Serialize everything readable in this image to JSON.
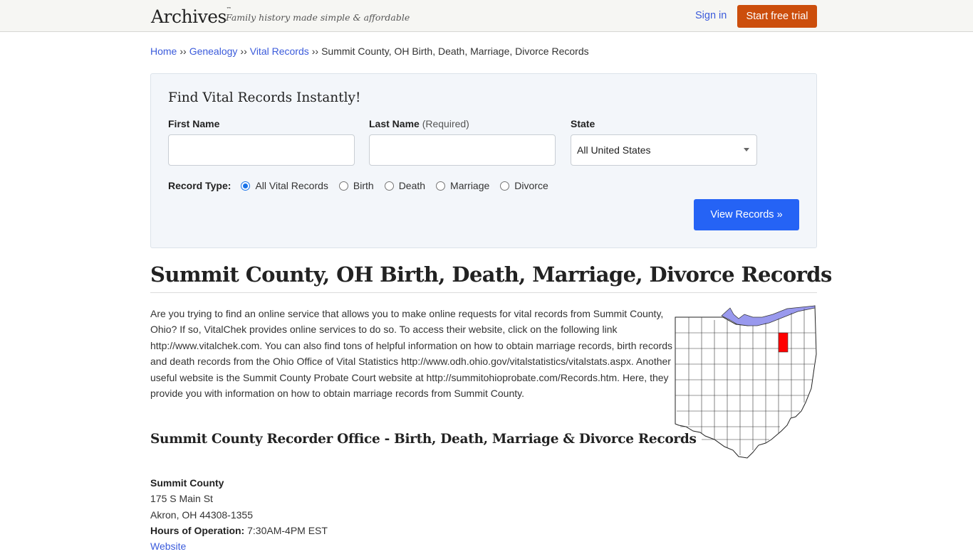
{
  "header": {
    "logo": "Archives",
    "logo_mark": "™",
    "tagline": "Family history made simple & affordable",
    "sign_in": "Sign in",
    "start_trial": "Start free trial",
    "colors": {
      "trial_button": "#cc4e0c",
      "link": "#3b5bdb"
    }
  },
  "breadcrumb": {
    "items": [
      "Home",
      "Genealogy",
      "Vital Records"
    ],
    "separator": "››",
    "current": "Summit County, OH Birth, Death, Marriage, Divorce Records"
  },
  "search": {
    "title": "Find Vital Records Instantly!",
    "first_name_label": "First Name",
    "first_name_value": "",
    "last_name_label": "Last Name",
    "last_name_required": "(Required)",
    "last_name_value": "",
    "state_label": "State",
    "state_selected": "All United States",
    "record_type_label": "Record Type:",
    "record_types": [
      {
        "label": "All Vital Records",
        "checked": true
      },
      {
        "label": "Birth",
        "checked": false
      },
      {
        "label": "Death",
        "checked": false
      },
      {
        "label": "Marriage",
        "checked": false
      },
      {
        "label": "Divorce",
        "checked": false
      }
    ],
    "submit": "View Records »",
    "colors": {
      "submit_button": "#2563f5",
      "box_bg": "#f3f6fa"
    }
  },
  "main": {
    "title": "Summit County, OH Birth, Death, Marriage, Divorce Records",
    "intro": "Are you trying to find an online service that allows you to make online requests for vital records from Summit County, Ohio? If so, VitalChek provides online services to do so. To access their website, click on the following link http://www.vitalchek.com. You can also find tons of helpful information on how to obtain marriage records, birth records and death records from the Ohio Office of Vital Statistics http://www.odh.ohio.gov/vitalstatistics/vitalstats.aspx. Another useful website is the Summit County Probate Court website at http://summitohioprobate.com/Records.htm. Here, they provide you with information on how to obtain marriage records from Summit County.",
    "map": {
      "label": "Ohio county map with Summit County highlighted",
      "colors": {
        "highlight": "#ff0000",
        "lake": "#9999ee"
      }
    },
    "office_section_title": "Summit County Recorder Office - Birth, Death, Marriage & Divorce Records",
    "office": {
      "name": "Summit County",
      "street": "175 S Main St",
      "city": "Akron, OH 44308-1355",
      "hours_label": "Hours of Operation:",
      "hours": "7:30AM-4PM EST",
      "website_link": "Website"
    }
  }
}
